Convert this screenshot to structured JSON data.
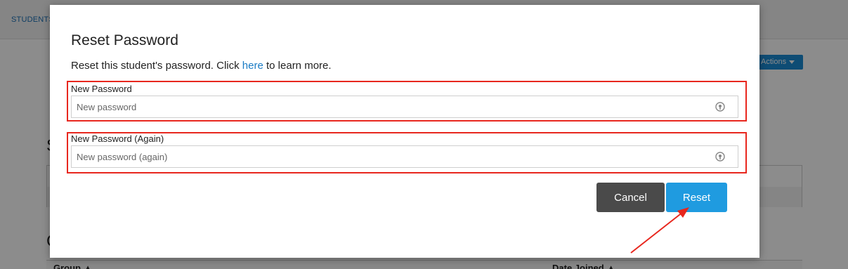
{
  "background": {
    "breadcrumb": "STUDENTS",
    "actions_label": "Actions",
    "section_s_initial": "S",
    "section_c_initial": "C",
    "table_col_group": "Group ▲",
    "table_col_date": "Date Joined ▲"
  },
  "modal": {
    "title": "Reset Password",
    "description_prefix": "Reset this student's password. Click ",
    "description_link": "here",
    "description_suffix": " to learn more.",
    "fields": [
      {
        "label": "New Password",
        "placeholder": "New password",
        "value": ""
      },
      {
        "label": "New Password (Again)",
        "placeholder": "New password (again)",
        "value": ""
      }
    ],
    "cancel_label": "Cancel",
    "reset_label": "Reset"
  },
  "colors": {
    "highlight": "#e8271e",
    "primary": "#1f9be0",
    "secondary": "#4a4a4a",
    "link": "#1a7bc4"
  },
  "icons": [
    "password-manager-icon",
    "caret-down-icon"
  ]
}
